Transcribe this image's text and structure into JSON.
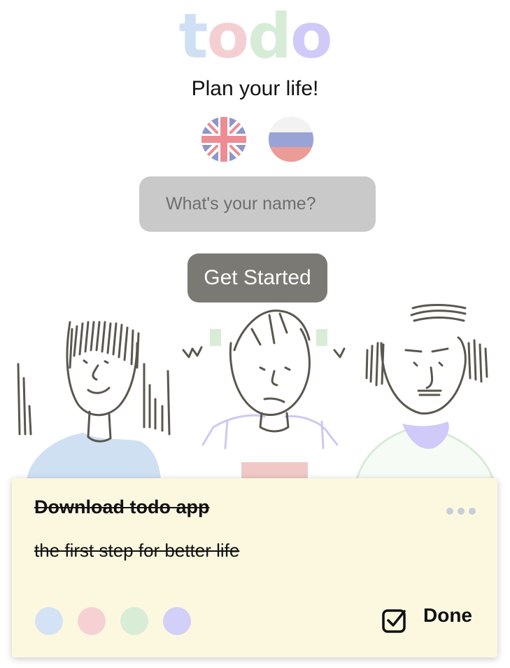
{
  "app": {
    "logo_letters": [
      "t",
      "o",
      "d",
      "o"
    ],
    "tagline": "Plan your life!"
  },
  "colors": {
    "logo": [
      "#cfe0f5",
      "#f4cfd2",
      "#d7ecd6",
      "#cfcaf7"
    ],
    "input_bg": "#c9c9c9",
    "button_bg": "#7a7974",
    "card_bg": "#fcf8e0"
  },
  "languages": [
    {
      "name": "english-flag-icon"
    },
    {
      "name": "russian-flag-icon"
    }
  ],
  "form": {
    "name_placeholder": "What's your name?",
    "submit_label": "Get Started"
  },
  "task_card": {
    "title": "Download todo app",
    "description": "the first step for better life",
    "completed": true,
    "done_label": "Done",
    "color_options": [
      "#d4e2f6",
      "#f6d1d3",
      "#d8ecd6",
      "#d2cff8"
    ]
  },
  "illustration": {
    "icon": "three-people-illustration"
  }
}
